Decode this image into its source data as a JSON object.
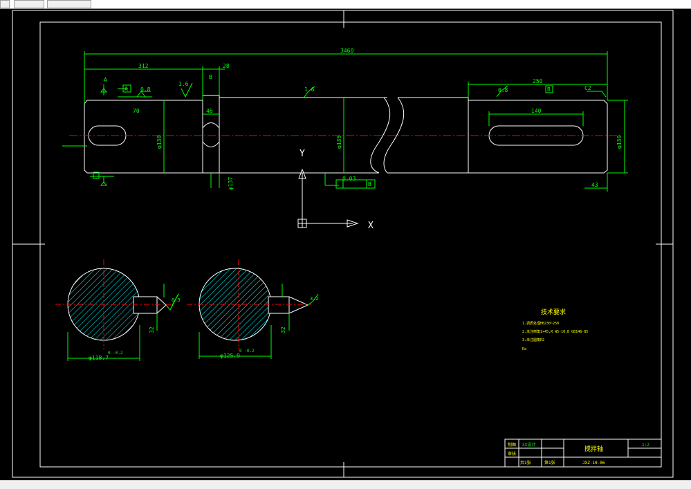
{
  "colors": {
    "background": "#000000",
    "line": "#ffffff",
    "dim": "#00ff00",
    "center": "#ff0000",
    "text_yellow": "#ffff00",
    "text_green": "#00ff00"
  },
  "dimensions": {
    "overall_length": "3460",
    "left_len": "312",
    "collar": "28",
    "groove": "46",
    "right_len": "250",
    "key_right": "140",
    "end_chamfer": "C2",
    "right_offset": "43",
    "left_key": "70",
    "datum_a": "A",
    "datum_b": "B",
    "sym_a": "A",
    "sym_b": "B",
    "rough1": "1.6",
    "rough2": "0.8",
    "rough3": "1.6",
    "rough4": "0.8",
    "dia_left": "φ130",
    "dia_mid": "φ135",
    "dia_right": "φ130",
    "dia_collar": "φ137",
    "tol_left": "+0.043\n+0.003",
    "tol_mid": "+0.040\n+0.015",
    "gtol_label": "0.03",
    "gtol_ref": "B",
    "axis_x": "X",
    "axis_y": "Y"
  },
  "sections": [
    {
      "dia": "φ118.7",
      "tol": "0\n-0.2",
      "key_w": "32",
      "rough": "6.3"
    },
    {
      "dia": "φ125.9",
      "tol": "0\n-0.2",
      "key_w": "32",
      "rough": "3.2"
    }
  ],
  "tech_requirements": {
    "title": "技术要求",
    "items": [
      "1.调质处理HB230~250",
      "2.未注倒角1×45,R W5-10.B GB146-85",
      "3.未注圆角R2",
      "Ra"
    ]
  },
  "title_block": {
    "name": "搅拌轴",
    "scale": "1:2",
    "drawing_no": "JXZ-10-06",
    "designer_label": "制图",
    "checker_label": "审核",
    "designer": "XX设计",
    "sheet_label": "共1张",
    "sheet_of": "第1张"
  }
}
